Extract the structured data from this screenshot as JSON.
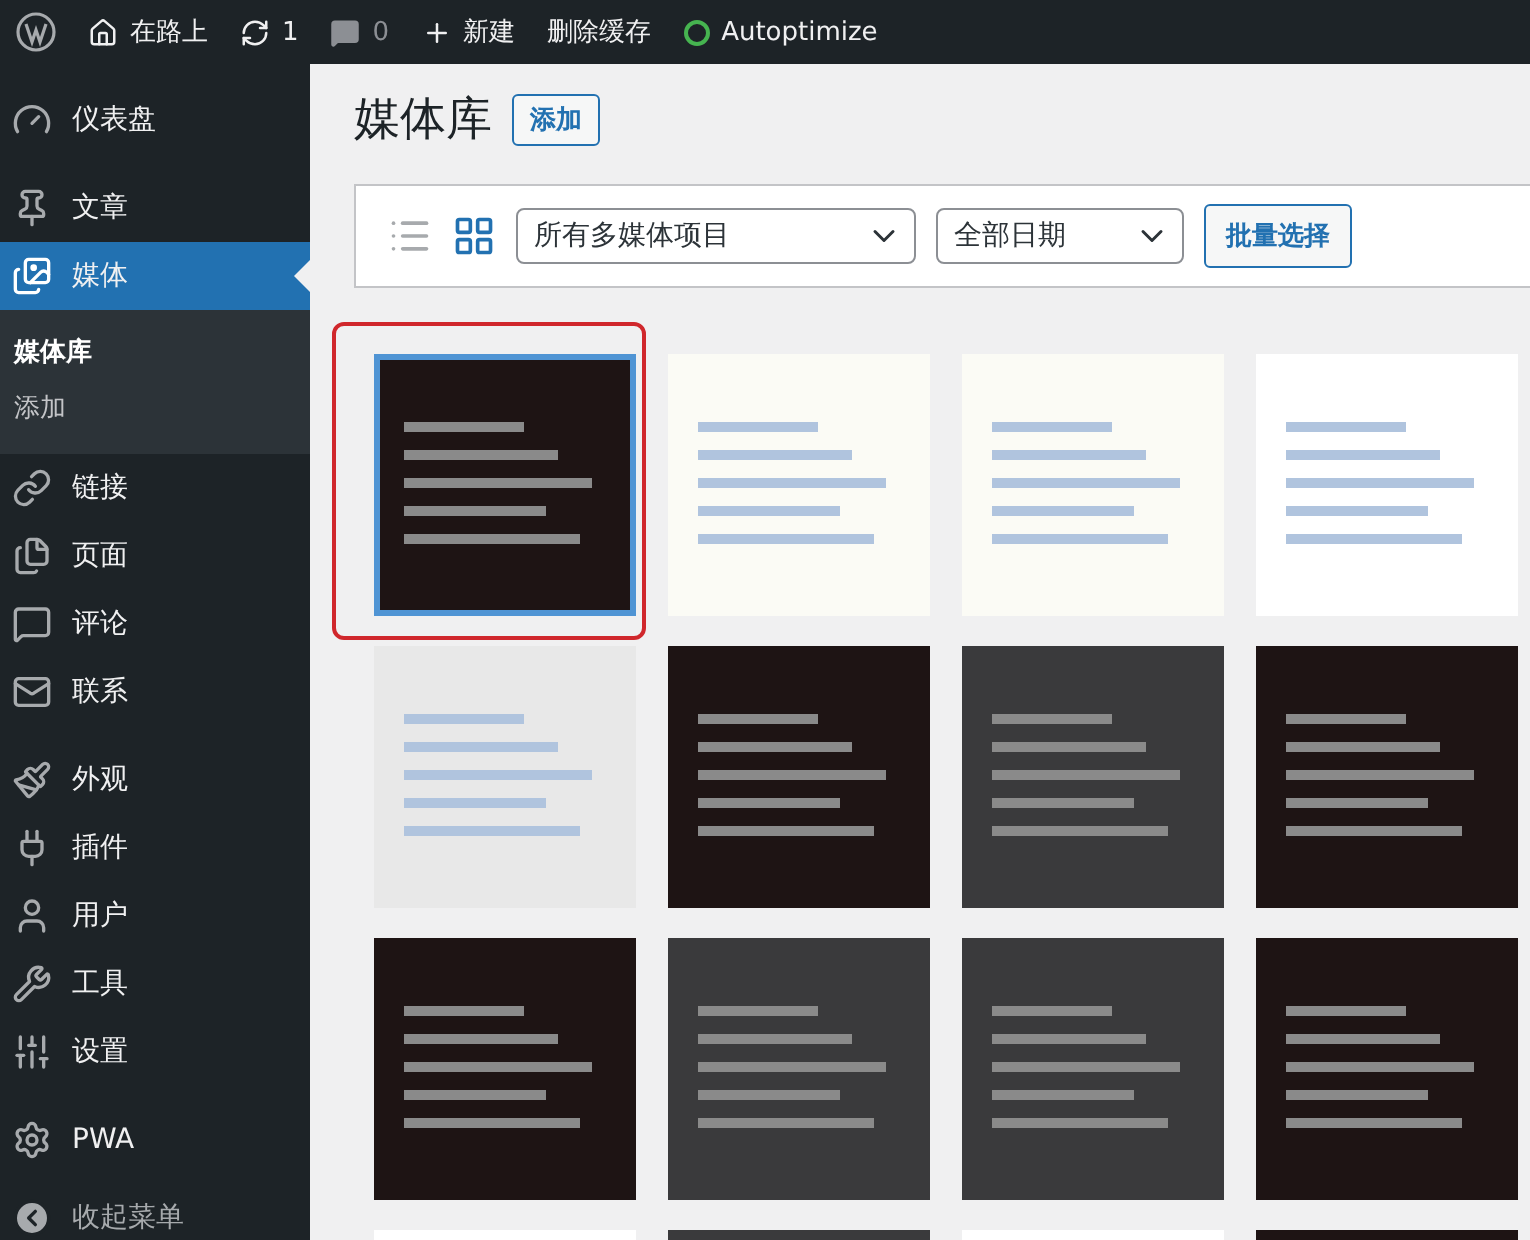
{
  "admin_bar": {
    "site": "在路上",
    "updates": "1",
    "comments": "0",
    "new": "新建",
    "clear_cache": "删除缓存",
    "plugin": "Autoptimize",
    "plugin_active": true
  },
  "sidebar": {
    "groups": [
      [
        {
          "label": "仪表盘",
          "selected": false
        }
      ],
      [
        {
          "label": "文章",
          "selected": false
        },
        {
          "label": "媒体",
          "selected": true,
          "submenu": [
            {
              "label": "媒体库",
              "selected": true
            },
            {
              "label": "添加",
              "selected": false
            }
          ]
        },
        {
          "label": "链接",
          "selected": false
        },
        {
          "label": "页面",
          "selected": false
        },
        {
          "label": "评论",
          "selected": false
        },
        {
          "label": "联系",
          "selected": false
        }
      ],
      [
        {
          "label": "外观",
          "selected": false
        },
        {
          "label": "插件",
          "selected": false
        },
        {
          "label": "用户",
          "selected": false
        },
        {
          "label": "工具",
          "selected": false
        },
        {
          "label": "设置",
          "selected": false
        }
      ],
      [
        {
          "label": "PWA",
          "selected": false
        }
      ]
    ],
    "collapse": "收起菜单"
  },
  "page": {
    "title": "媒体库",
    "add_button": "添加"
  },
  "toolbar": {
    "views": [
      {
        "kind": "list",
        "selected": false
      },
      {
        "kind": "grid",
        "selected": true
      }
    ],
    "type_filter": "所有多媒体项目",
    "date_filter": "全部日期",
    "bulk_select": "批量选择"
  },
  "media": [
    {
      "kind": "terminal",
      "selected": true,
      "annotated": true
    },
    {
      "kind": "diagram",
      "selected": false,
      "annotated": false
    },
    {
      "kind": "diagram",
      "selected": false,
      "annotated": false
    },
    {
      "kind": "document",
      "selected": false,
      "annotated": false
    },
    {
      "kind": "dialog",
      "selected": false,
      "annotated": false
    },
    {
      "kind": "terminal",
      "selected": false,
      "annotated": false
    },
    {
      "kind": "window",
      "selected": false,
      "annotated": false
    },
    {
      "kind": "terminal",
      "selected": false,
      "annotated": false
    },
    {
      "kind": "terminal",
      "selected": false,
      "annotated": false
    },
    {
      "kind": "window",
      "selected": false,
      "annotated": false
    },
    {
      "kind": "window",
      "selected": false,
      "annotated": false
    },
    {
      "kind": "terminal",
      "selected": false,
      "annotated": false
    },
    {
      "kind": "document",
      "selected": false,
      "annotated": false
    },
    {
      "kind": "window",
      "selected": false,
      "annotated": false
    },
    {
      "kind": "document",
      "selected": false,
      "annotated": false
    },
    {
      "kind": "terminal",
      "selected": false,
      "annotated": false
    }
  ]
}
